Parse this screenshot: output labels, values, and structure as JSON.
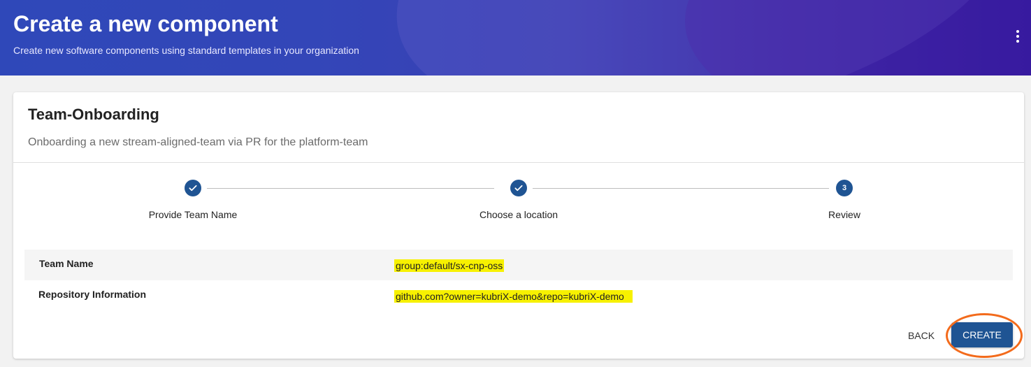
{
  "header": {
    "title": "Create a new component",
    "subtitle": "Create new software components using standard templates in your organization",
    "menu_icon": "more-vert-icon"
  },
  "template": {
    "title": "Team-Onboarding",
    "description": "Onboarding a new stream-aligned-team via PR for the platform-team"
  },
  "stepper": {
    "steps": [
      {
        "label": "Provide Team Name",
        "state": "completed",
        "icon": "check-icon"
      },
      {
        "label": "Choose a location",
        "state": "completed",
        "icon": "check-icon"
      },
      {
        "label": "Review",
        "state": "active",
        "number": "3"
      }
    ]
  },
  "review": {
    "rows": [
      {
        "key": "Team Name",
        "value": "group:default/sx-cnp-oss"
      },
      {
        "key": "Repository Information",
        "value": "github.com?owner=kubriX-demo&repo=kubriX-demo"
      }
    ]
  },
  "actions": {
    "back_label": "BACK",
    "create_label": "CREATE"
  },
  "colors": {
    "primary": "#1f5493",
    "highlight": "#f7f100",
    "annotation_ring": "#f36b1c"
  }
}
